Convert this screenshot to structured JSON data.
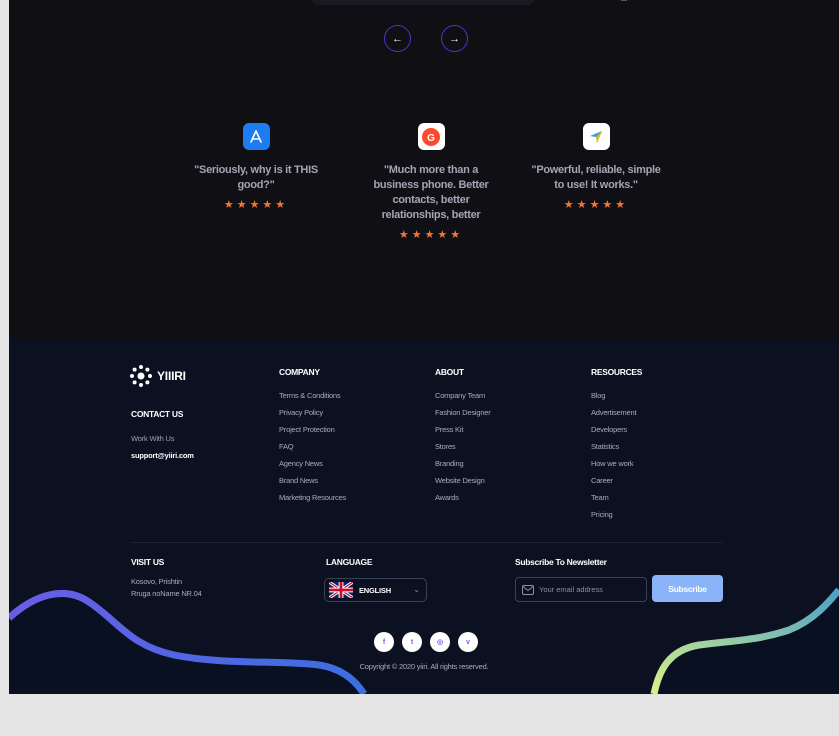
{
  "nav": {
    "prev": "←",
    "next": "→"
  },
  "reviews": [
    {
      "icon": "app-store-icon",
      "icon_color": "#1e7cf2",
      "quote": "\"Seriously, why is it THIS good?\"",
      "stars": "★★★★★"
    },
    {
      "icon": "g2-icon",
      "icon_color": "#ffffff",
      "quote": "\"Much more than a business phone. Better contacts, better relationships, better",
      "stars": "★★★★★"
    },
    {
      "icon": "navigation-arrow-icon",
      "icon_color": "#ffffff",
      "quote": "\"Powerful, reliable, simple to use! It works.\"",
      "stars": "★★★★★"
    }
  ],
  "footer": {
    "brand": "YIIIRI",
    "contact": {
      "title": "CONTACT US",
      "label": "Work With Us",
      "email": "support@yiiri.com"
    },
    "columns": [
      {
        "title": "COMPANY",
        "links": [
          "Terms & Conditions",
          "Privacy Policy",
          "Project Protection",
          "FAQ",
          "Agency News",
          "Brand News",
          "Marketing Resources"
        ]
      },
      {
        "title": "ABOUT",
        "links": [
          "Company Team",
          "Fashion Designer",
          "Press Kit",
          "Stores",
          "Branding",
          "Website Design",
          "Awards"
        ]
      },
      {
        "title": "RESOURCES",
        "links": [
          "Blog",
          "Advertisement",
          "Developers",
          "Statistics",
          "How we work",
          "Career",
          "Team",
          "Pricing"
        ]
      }
    ],
    "visit": {
      "title": "VISIT US",
      "line1": "Kosovo, Prishtin",
      "line2": "Rruga noName NR.04"
    },
    "language": {
      "title": "LANGUAGE",
      "selected": "ENGLISH"
    },
    "newsletter": {
      "title": "Subscribe To Newsletter",
      "placeholder": "Your email address",
      "button": "Subscribe"
    },
    "socials": [
      "f",
      "t",
      "◎",
      "v"
    ],
    "copyright": "Copyright © 2020 yiiri. All rights reserved."
  },
  "colors": {
    "accent": "#4a37c9",
    "star": "#f4743b",
    "button": "#8ab4f7",
    "background": "#0f0f14",
    "footer": "#0b1120"
  }
}
